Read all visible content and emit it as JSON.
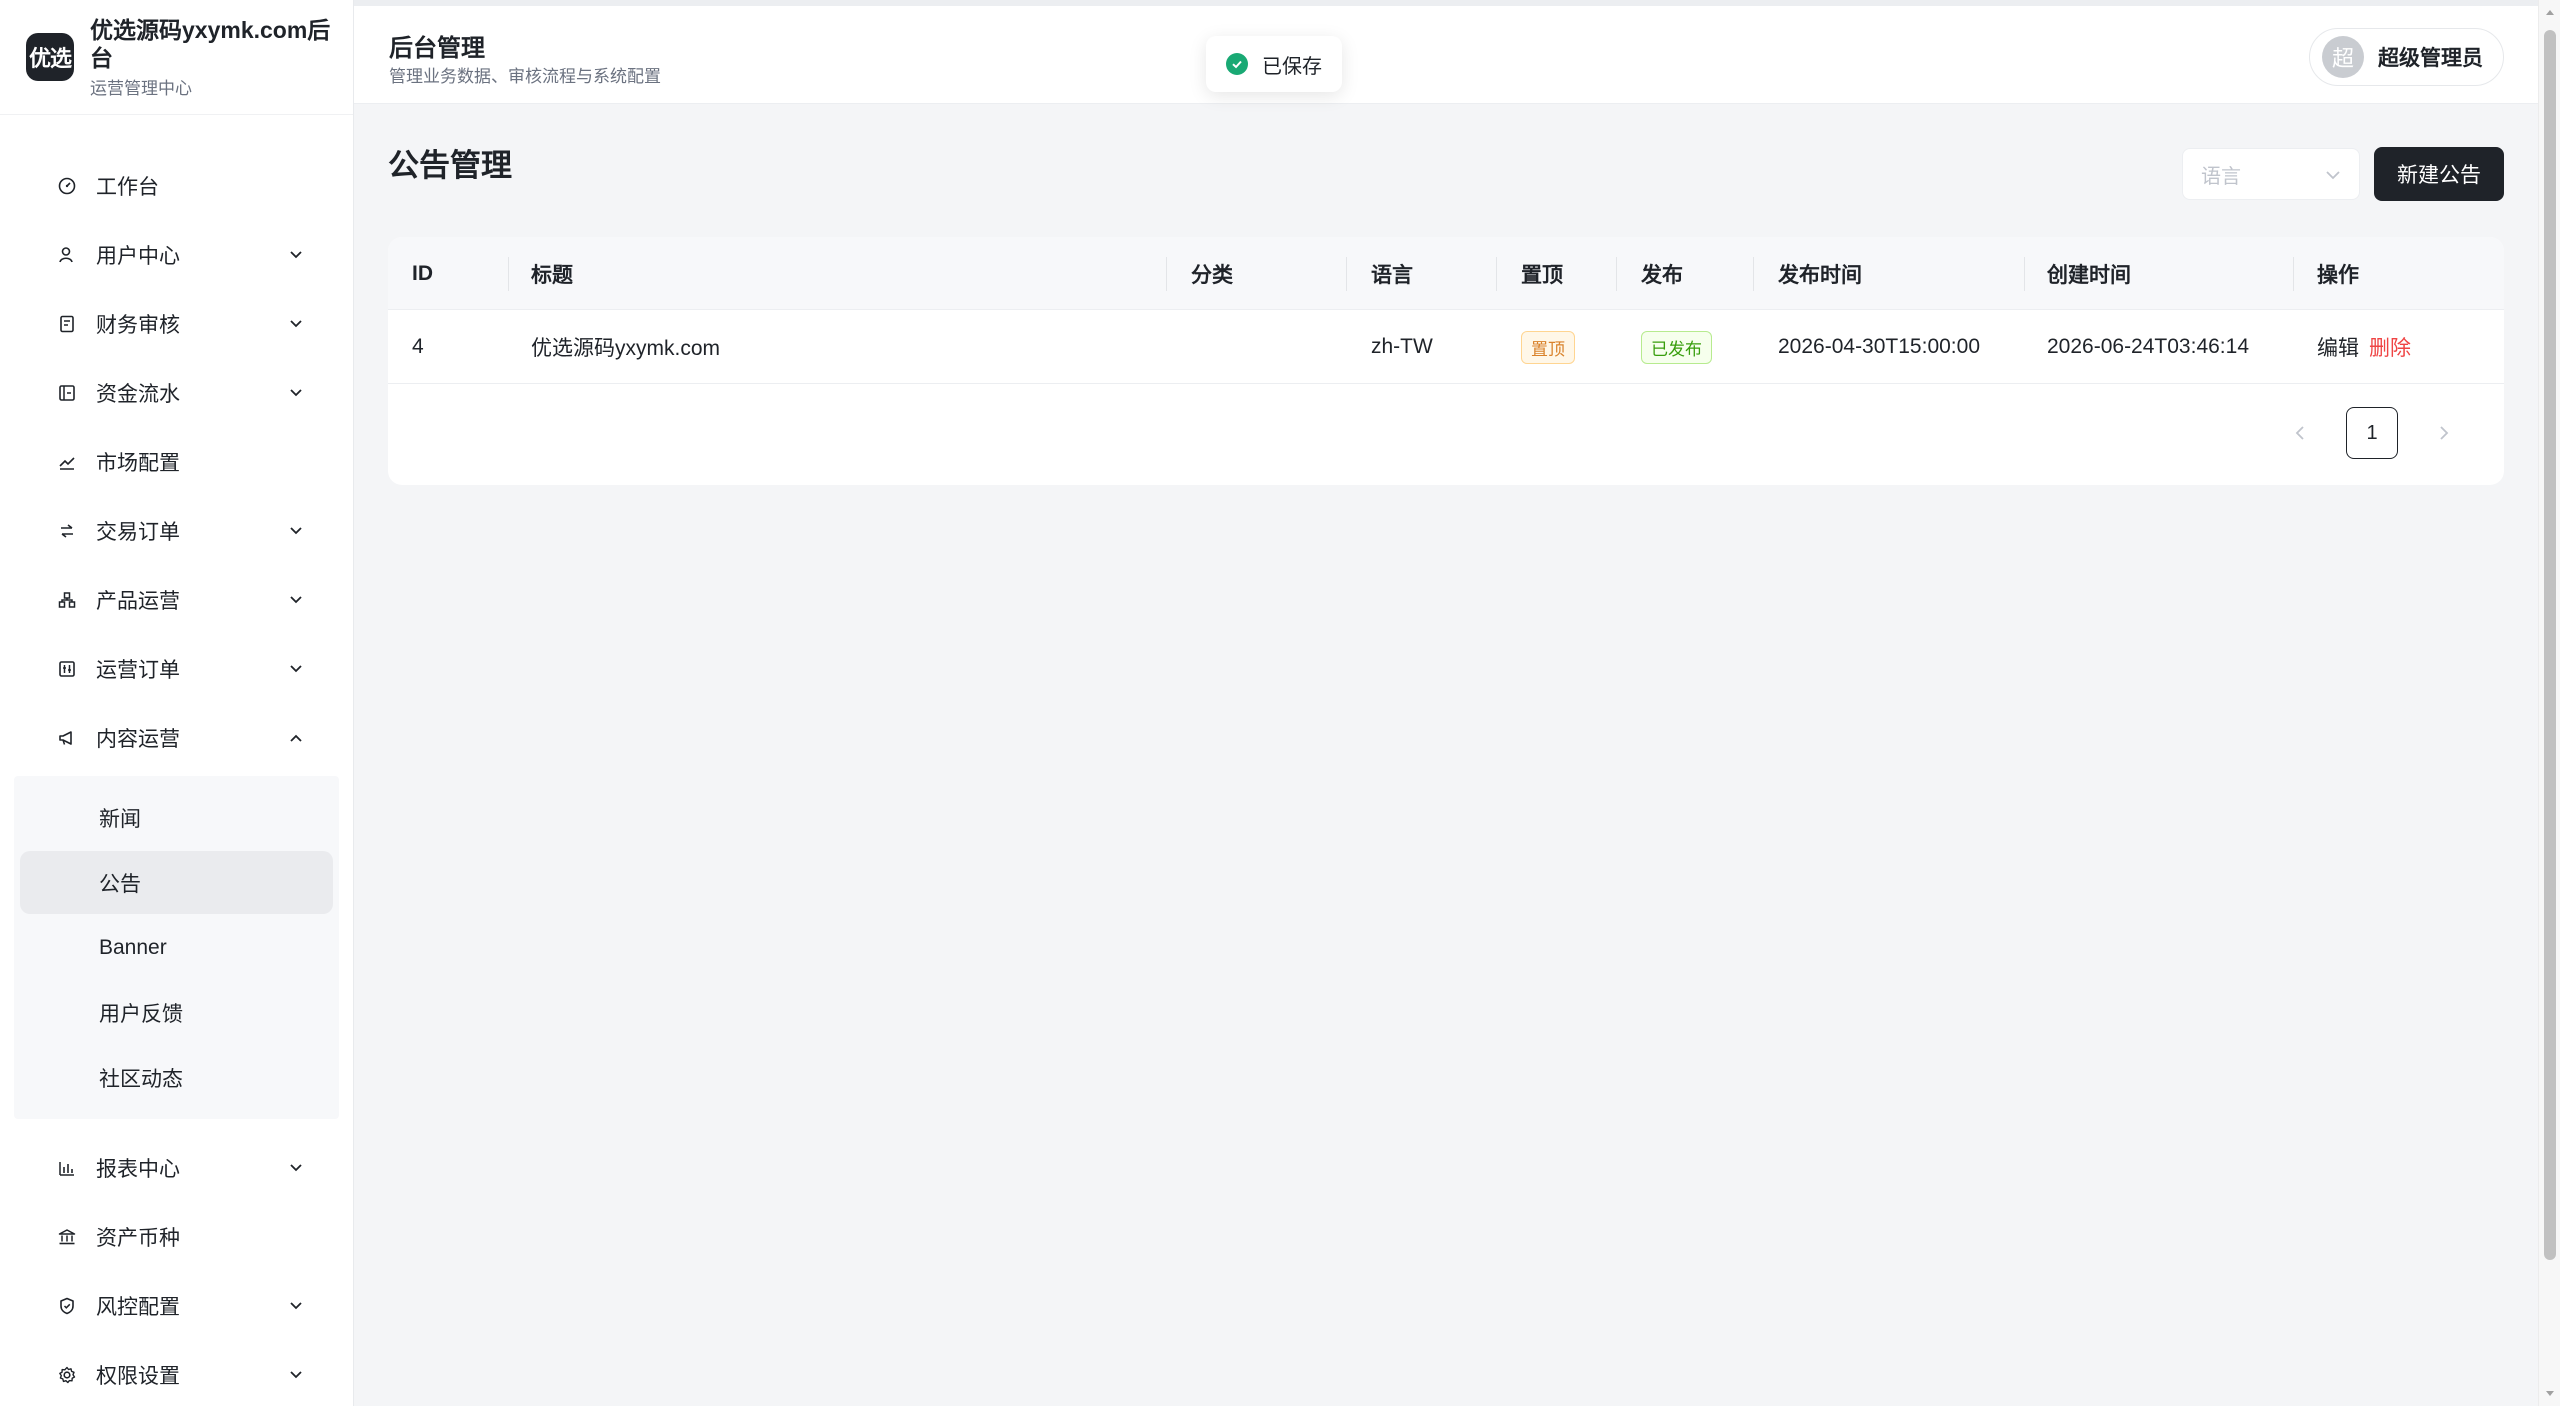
{
  "brand": {
    "logo_text": "优选",
    "name": "优选源码yxymk.com后台",
    "subtitle": "运营管理中心"
  },
  "menu": {
    "items_top": [
      {
        "label": "工作台",
        "icon": "dashboard-icon",
        "expandable": false
      },
      {
        "label": "用户中心",
        "icon": "user-icon",
        "expandable": true
      },
      {
        "label": "财务审核",
        "icon": "finance-icon",
        "expandable": true
      },
      {
        "label": "资金流水",
        "icon": "wallet-icon",
        "expandable": true
      },
      {
        "label": "市场配置",
        "icon": "chart-line-icon",
        "expandable": false
      },
      {
        "label": "交易订单",
        "icon": "swap-icon",
        "expandable": true
      },
      {
        "label": "产品运营",
        "icon": "org-icon",
        "expandable": true
      },
      {
        "label": "运营订单",
        "icon": "ops-order-icon",
        "expandable": true
      },
      {
        "label": "内容运营",
        "icon": "megaphone-icon",
        "expandable": true,
        "expanded": true
      }
    ],
    "submenu": [
      {
        "label": "新闻"
      },
      {
        "label": "公告",
        "active": true
      },
      {
        "label": "Banner"
      },
      {
        "label": "用户反馈"
      },
      {
        "label": "社区动态"
      }
    ],
    "items_bottom": [
      {
        "label": "报表中心",
        "icon": "bar-chart-icon",
        "expandable": true
      },
      {
        "label": "资产币种",
        "icon": "bank-icon",
        "expandable": false
      },
      {
        "label": "风控配置",
        "icon": "shield-icon",
        "expandable": true
      },
      {
        "label": "权限设置",
        "icon": "gear-icon",
        "expandable": true
      }
    ]
  },
  "header": {
    "title": "后台管理",
    "subtitle": "管理业务数据、审核流程与系统配置",
    "toast": "已保存",
    "user_avatar": "超",
    "user_name": "超级管理员"
  },
  "page": {
    "title": "公告管理",
    "language_placeholder": "语言",
    "new_button": "新建公告"
  },
  "table": {
    "columns": [
      "ID",
      "标题",
      "分类",
      "语言",
      "置顶",
      "发布",
      "发布时间",
      "创建时间",
      "操作"
    ],
    "rows": [
      {
        "id": "4",
        "title": "优选源码yxymk.com",
        "category": "",
        "language": "zh-TW",
        "pinned": "置顶",
        "published": "已发布",
        "publish_time": "2026-04-30T15:00:00",
        "created_time": "2026-06-24T03:46:14",
        "edit": "编辑",
        "delete": "删除"
      }
    ]
  },
  "pagination": {
    "current_page": "1"
  }
}
